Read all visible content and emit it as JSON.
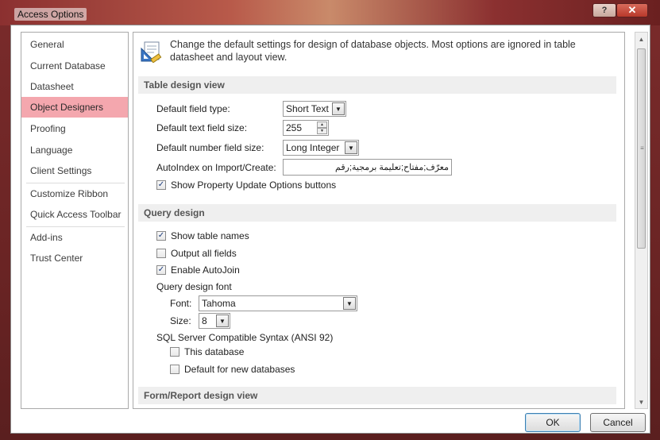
{
  "window": {
    "title": "Access Options",
    "help_label": "?",
    "close_label": "✕"
  },
  "nav": {
    "items": [
      {
        "label": "General"
      },
      {
        "label": "Current Database"
      },
      {
        "label": "Datasheet"
      },
      {
        "label": "Object Designers",
        "active": true
      },
      {
        "label": "Proofing"
      },
      {
        "label": "Language"
      },
      {
        "label": "Client Settings"
      },
      {
        "label": "Customize Ribbon"
      },
      {
        "label": "Quick Access Toolbar"
      },
      {
        "label": "Add-ins"
      },
      {
        "label": "Trust Center"
      }
    ]
  },
  "intro": {
    "icon": "design-settings-icon",
    "text": "Change the default settings for design of database objects. Most options are ignored in table datasheet and layout view."
  },
  "table_design": {
    "header": "Table design view",
    "field_type_label": "Default field type:",
    "field_type_value": "Short Text",
    "text_size_label": "Default text field size:",
    "text_size_value": "255",
    "number_size_label": "Default number field size:",
    "number_size_value": "Long Integer",
    "autoindex_label": "AutoIndex on Import/Create:",
    "autoindex_value": "معرّف;مفتاح;تعليمة برمجية;رقم",
    "show_property_label": "Show Property Update Options buttons",
    "show_property_checked": true
  },
  "query_design": {
    "header": "Query design",
    "show_table_names_label": "Show table names",
    "show_table_names_checked": true,
    "output_all_fields_label": "Output all fields",
    "output_all_fields_checked": false,
    "enable_autojoin_label": "Enable AutoJoin",
    "enable_autojoin_checked": true,
    "font_group_label": "Query design font",
    "font_label": "Font:",
    "font_value": "Tahoma",
    "size_label": "Size:",
    "size_value": "8",
    "sql_label": "SQL Server Compatible Syntax (ANSI 92)",
    "this_db_label": "This database",
    "this_db_checked": false,
    "default_new_label": "Default for new databases",
    "default_new_checked": false
  },
  "form_report": {
    "header": "Form/Report design view"
  },
  "footer": {
    "ok_label": "OK",
    "cancel_label": "Cancel"
  },
  "colors": {
    "active_nav": "#f4a7ae",
    "frame": "#7a2b2b",
    "section_bg": "#efefef"
  }
}
